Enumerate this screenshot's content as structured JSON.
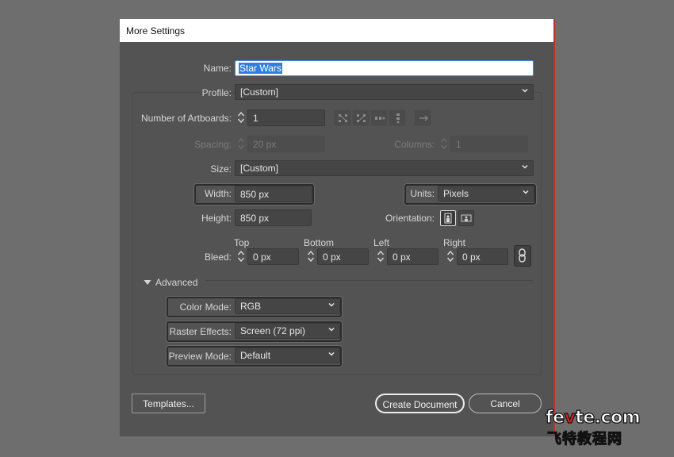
{
  "dialog": {
    "title": "More Settings"
  },
  "name": {
    "label": "Name:",
    "value": "Star Wars"
  },
  "profile": {
    "label": "Profile:",
    "value": "[Custom]"
  },
  "artboards": {
    "label": "Number of Artboards:",
    "value": "1",
    "spacing_label": "Spacing:",
    "spacing_value": "20 px",
    "columns_label": "Columns:",
    "columns_value": "1",
    "arrangement_icons": [
      "grid-by-row-icon",
      "grid-by-column-icon",
      "arrange-by-row-icon",
      "arrange-by-column-icon",
      "right-to-left-icon"
    ]
  },
  "size": {
    "label": "Size:",
    "value": "[Custom]"
  },
  "width": {
    "label": "Width:",
    "value": "850 px"
  },
  "height": {
    "label": "Height:",
    "value": "850 px"
  },
  "units": {
    "label": "Units:",
    "value": "Pixels"
  },
  "orientation": {
    "label": "Orientation:",
    "selected": "portrait"
  },
  "bleed": {
    "label": "Bleed:",
    "top_label": "Top",
    "top_value": "0 px",
    "bottom_label": "Bottom",
    "bottom_value": "0 px",
    "left_label": "Left",
    "left_value": "0 px",
    "right_label": "Right",
    "right_value": "0 px"
  },
  "advanced": {
    "label": "Advanced",
    "color_mode_label": "Color Mode:",
    "color_mode_value": "RGB",
    "raster_label": "Raster Effects:",
    "raster_value": "Screen (72 ppi)",
    "preview_label": "Preview Mode:",
    "preview_value": "Default"
  },
  "buttons": {
    "templates": "Templates...",
    "create": "Create Document",
    "cancel": "Cancel"
  },
  "watermark": {
    "line1_a": "fe",
    "line1_b": "v",
    "line1_c": "te.com",
    "line2": "飞特教程网"
  },
  "colors": {
    "dialog_bg": "#535353",
    "field_bg": "#454545",
    "selection": "#2f7fe0",
    "accent_line": "#b8342f"
  }
}
